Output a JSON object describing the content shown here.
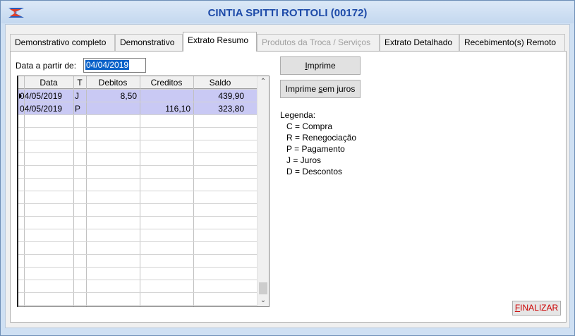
{
  "window": {
    "title": "CINTIA SPITTI ROTTOLI (00172)",
    "icon": "app-logo-icon"
  },
  "tabs": [
    {
      "label": "Demonstrativo completo",
      "state": "normal"
    },
    {
      "label": "Demonstrativo",
      "state": "normal"
    },
    {
      "label": "Extrato Resumo",
      "state": "active"
    },
    {
      "label": "Produtos da Troca / Serviços",
      "state": "disabled"
    },
    {
      "label": "Extrato Detalhado",
      "state": "normal"
    },
    {
      "label": "Recebimento(s) Remoto",
      "state": "normal"
    }
  ],
  "filter": {
    "label": "Data a partir de:",
    "value": "04/04/2019"
  },
  "grid": {
    "columns": [
      "Data",
      "T",
      "Debitos",
      "Creditos",
      "Saldo"
    ],
    "rows": [
      {
        "data": "04/05/2019",
        "t": "J",
        "debitos": "8,50",
        "creditos": "",
        "saldo": "439,90"
      },
      {
        "data": "04/05/2019",
        "t": "P",
        "debitos": "",
        "creditos": "116,10",
        "saldo": "323,80"
      }
    ]
  },
  "buttons": {
    "imprime": {
      "pre": "",
      "accel": "I",
      "post": "mprime"
    },
    "imprime_sem_juros": {
      "pre": "Imprime ",
      "accel": "s",
      "post": "em juros"
    },
    "finalizar": {
      "pre": "",
      "accel": "F",
      "post": "INALIZAR"
    }
  },
  "legend": {
    "title": "Legenda:",
    "items": [
      "C = Compra",
      "R = Renegociação",
      "P = Pagamento",
      "J = Juros",
      "D = Descontos"
    ]
  },
  "colors": {
    "title_text": "#1d4aa8",
    "selected_row": "#c9c9f4",
    "date_highlight": "#0a62c9",
    "finalizar_text": "#cc0000"
  }
}
